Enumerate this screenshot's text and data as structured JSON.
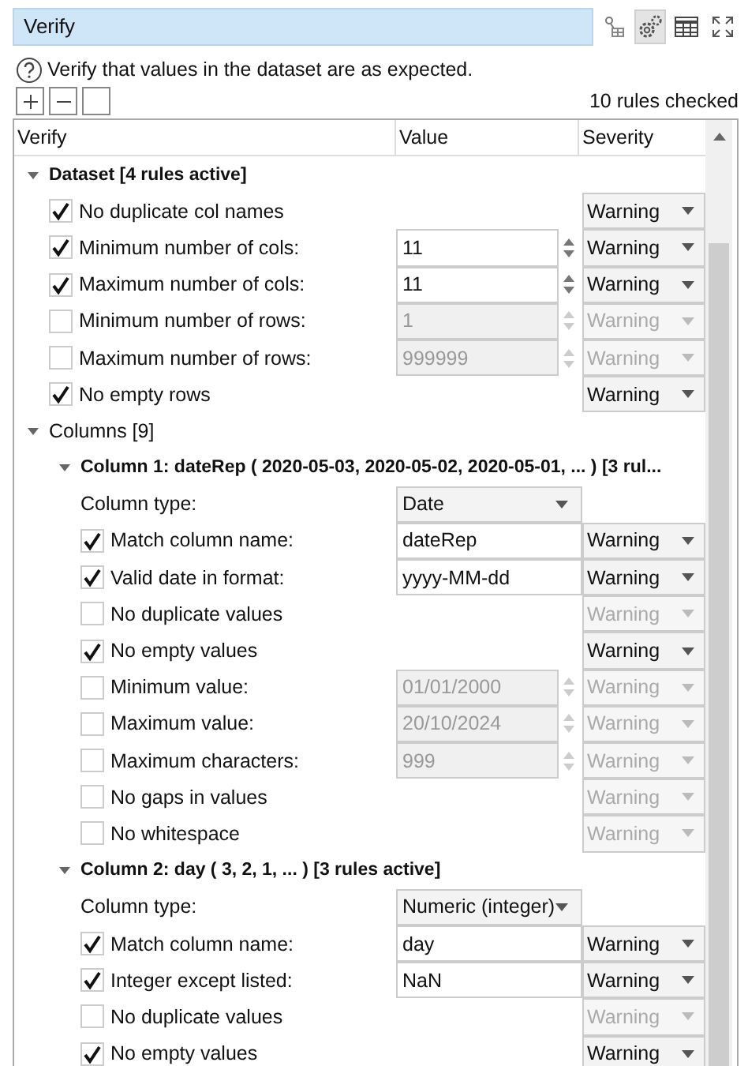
{
  "panel": {
    "title": "Verify"
  },
  "help_text": "Verify that values in the dataset are as expected.",
  "rules_checked": "10 rules checked",
  "table": {
    "columns": [
      "Verify",
      "Value",
      "Severity"
    ],
    "tree": [
      {
        "kind": "group",
        "label": "Dataset [4 rules active]",
        "expanded": true,
        "items": [
          {
            "kind": "rule",
            "label": "No duplicate col names",
            "checked": true,
            "severity": "Warning"
          },
          {
            "kind": "rule",
            "label": "Minimum number of cols:",
            "checked": true,
            "field": {
              "text": "11",
              "spinner": true
            },
            "severity": "Warning"
          },
          {
            "kind": "rule",
            "label": "Maximum number of cols:",
            "checked": true,
            "field": {
              "text": "11",
              "spinner": true
            },
            "severity": "Warning"
          },
          {
            "kind": "rule",
            "label": "Minimum number of rows:",
            "checked": false,
            "field": {
              "text": "1",
              "spinner": true
            },
            "severity": "Warning"
          },
          {
            "kind": "rule",
            "label": "Maximum number of rows:",
            "checked": false,
            "field": {
              "text": "999999",
              "spinner": true
            },
            "severity": "Warning"
          },
          {
            "kind": "rule",
            "label": "No empty rows",
            "checked": true,
            "severity": "Warning"
          }
        ]
      },
      {
        "kind": "folder",
        "label": "Columns [9]",
        "expanded": true,
        "children": [
          {
            "kind": "group",
            "label": "Column 1: dateRep ( 2020-05-03, 2020-05-02, 2020-05-01, ... ) [3 rul...",
            "expanded": true,
            "items": [
              {
                "kind": "type",
                "label": "Column type:",
                "value": "Date"
              },
              {
                "kind": "rule",
                "label": "Match column name:",
                "checked": true,
                "field": {
                  "text": "dateRep",
                  "spinner": false
                },
                "severity": "Warning"
              },
              {
                "kind": "rule",
                "label": "Valid date in format:",
                "checked": true,
                "field": {
                  "text": "yyyy-MM-dd",
                  "spinner": false
                },
                "severity": "Warning"
              },
              {
                "kind": "rule",
                "label": "No duplicate values",
                "checked": false,
                "severity": "Warning"
              },
              {
                "kind": "rule",
                "label": "No empty values",
                "checked": true,
                "severity": "Warning"
              },
              {
                "kind": "rule",
                "label": "Minimum value:",
                "checked": false,
                "field": {
                  "text": "01/01/2000",
                  "spinner": true
                },
                "severity": "Warning"
              },
              {
                "kind": "rule",
                "label": "Maximum value:",
                "checked": false,
                "field": {
                  "text": "20/10/2024",
                  "spinner": true
                },
                "severity": "Warning"
              },
              {
                "kind": "rule",
                "label": "Maximum characters:",
                "checked": false,
                "field": {
                  "text": "999",
                  "spinner": true
                },
                "severity": "Warning"
              },
              {
                "kind": "rule",
                "label": "No gaps in values",
                "checked": false,
                "severity": "Warning"
              },
              {
                "kind": "rule",
                "label": "No whitespace",
                "checked": false,
                "severity": "Warning"
              }
            ]
          },
          {
            "kind": "group",
            "label": "Column 2: day ( 3, 2, 1, ... ) [3 rules active]",
            "expanded": true,
            "items": [
              {
                "kind": "type",
                "label": "Column type:",
                "value": "Numeric (integer)"
              },
              {
                "kind": "rule",
                "label": "Match column name:",
                "checked": true,
                "field": {
                  "text": "day",
                  "spinner": false
                },
                "severity": "Warning"
              },
              {
                "kind": "rule",
                "label": "Integer except listed:",
                "checked": true,
                "field": {
                  "text": "NaN",
                  "spinner": false
                },
                "severity": "Warning"
              },
              {
                "kind": "rule",
                "label": "No duplicate values",
                "checked": false,
                "severity": "Warning"
              },
              {
                "kind": "rule",
                "label": "No empty values",
                "checked": true,
                "severity": "Warning"
              }
            ]
          }
        ]
      }
    ]
  }
}
